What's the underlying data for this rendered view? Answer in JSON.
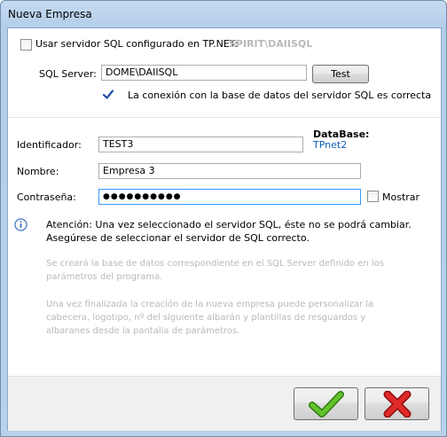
{
  "window": {
    "title": "Nueva Empresa"
  },
  "sql_config": {
    "checkbox_label": "Usar servidor SQL configurado en TP.NET:",
    "configured_server": "SPIRIT\\DAIISQL",
    "server_label": "SQL Server:",
    "server_value": "DOME\\DAIISQL",
    "test_button": "Test",
    "connection_status": "La conexión con la base de datos del servidor SQL es correcta"
  },
  "form": {
    "identificador_label": "Identificador:",
    "identificador_value": "TEST3",
    "database_label": "DataBase:",
    "database_value": "TPnet2",
    "nombre_label": "Nombre:",
    "nombre_value": "Empresa 3",
    "password_label": "Contraseña:",
    "password_value": "●●●●●●●●●●",
    "mostrar_label": "Mostrar"
  },
  "notes": {
    "attention": "Atención: Una vez seleccionado el servidor SQL, éste no se podrá cambiar. Asegúrese de seleccionar el servidor de SQL correcto.",
    "note1": "Se creará la base de datos correspondiente en el SQL Server definido en los parámetros del programa.",
    "note2": "Una vez finalizada la creación de la nueva empresa puede personalizar la cabecera, logotipo, nº del siguiente albarán y plantillas de resguardos y albaranes desde la pantalla de parámetros."
  },
  "colors": {
    "accent": "#0b5fb8",
    "ok_green": "#3a9a1a",
    "cancel_red": "#d01818"
  },
  "icons": {
    "info": "info-icon",
    "check": "checkmark-icon",
    "ok": "green-check-icon",
    "cancel": "red-x-icon"
  }
}
